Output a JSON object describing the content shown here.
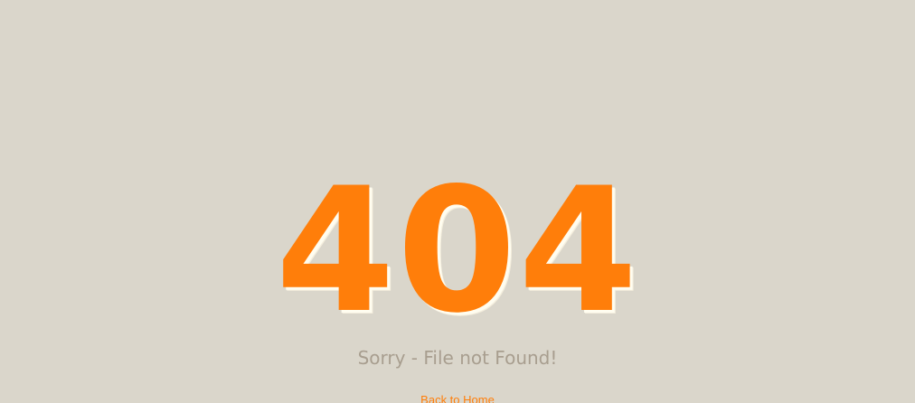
{
  "error": {
    "code": "404",
    "message": "Sorry - File not Found!",
    "back_link_label": "Back to Home"
  },
  "colors": {
    "background": "#dad6cb",
    "accent": "#ff7e0a",
    "message_text": "#a89e8f"
  }
}
